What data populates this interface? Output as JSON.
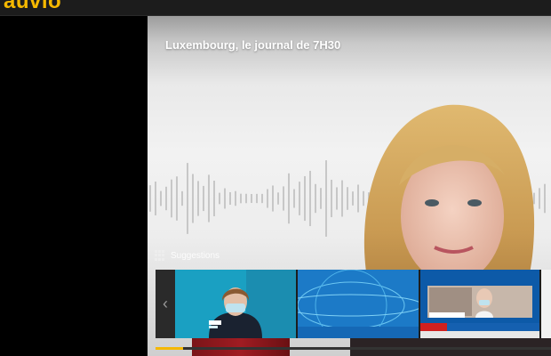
{
  "app": {
    "logo_text": "auvio"
  },
  "player": {
    "title": "Luxembourg, le journal de 7H30",
    "progress_fraction": 0.07
  },
  "suggestions": {
    "label": "Suggestions",
    "prev_icon": "chevron-left-icon"
  },
  "colors": {
    "brand": "#f5b800",
    "topbar": "#1c1c1c",
    "background": "#000000"
  }
}
